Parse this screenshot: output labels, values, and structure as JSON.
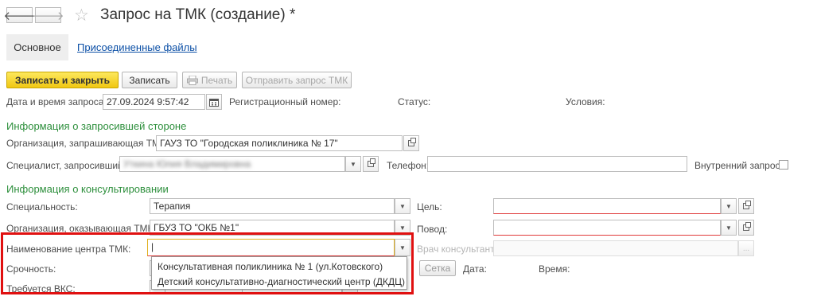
{
  "window": {
    "title": "Запрос на ТМК (создание) *",
    "back_glyph": "🡐",
    "forward_glyph": "🡒",
    "star_glyph": "☆"
  },
  "tabs": {
    "main": "Основное",
    "files": "Присоединенные файлы"
  },
  "toolbar": {
    "save_close": "Записать и закрыть",
    "save": "Записать",
    "print": "Печать",
    "send": "Отправить запрос ТМК"
  },
  "header_row": {
    "datetime_label": "Дата и время запроса:",
    "datetime_value": "27.09.2024  9:57:42",
    "regnum_label": "Регистрационный номер:",
    "status_label": "Статус:",
    "conditions_label": "Условия:"
  },
  "requester": {
    "section_title": "Информация о запросившей стороне",
    "org_label": "Организация, запрашивающая ТМК:",
    "org_value": "ГАУЗ ТО \"Городская поликлиника № 17\"",
    "specialist_label": "Специалист, запросивший:",
    "specialist_value": "Уткина Юлия Владимировна",
    "phone_label": "Телефон:",
    "phone_value": "",
    "internal_label": "Внутренний запрос:"
  },
  "consult": {
    "section_title": "Информация о консультировании",
    "specialty_label": "Специальность:",
    "specialty_value": "Терапия",
    "goal_label": "Цель:",
    "goal_value": "",
    "org_label": "Организация, оказывающая ТМК:",
    "org_value": "ГБУЗ ТО \"ОКБ №1\"",
    "reason_label": "Повод:",
    "reason_value": "",
    "center_label": "Наименование центра ТМК:",
    "center_value": "|",
    "doctor_label": "Врач консультант:",
    "doctor_value": "",
    "urgency_label": "Срочность:",
    "grid_button": "Сетка",
    "date_label": "Дата:",
    "time_label": "Время:",
    "vks_label": "Требуется ВКС:"
  },
  "dropdown": {
    "options": [
      "Консультативная поликлиника № 1 (ул.Котовского)",
      "Детский консультативно-диагностический центр (ДКДЦ)"
    ]
  },
  "glyphs": {
    "dropdown": "▼",
    "ellipsis": "..."
  }
}
